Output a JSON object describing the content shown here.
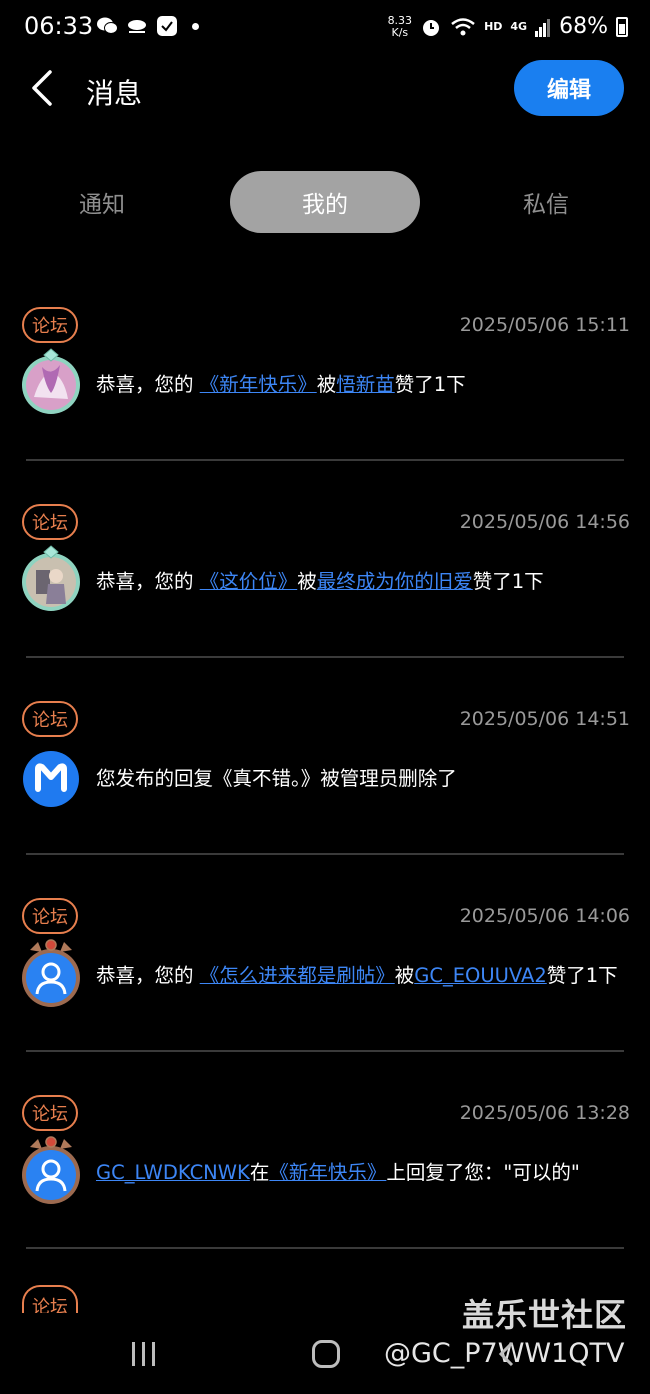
{
  "status_bar": {
    "time": "06:33",
    "speed_value": "8.33",
    "speed_unit": "K/s",
    "network_tag": "HD",
    "signal_tag": "4G",
    "battery": "68%"
  },
  "header": {
    "title": "消息",
    "edit_label": "编辑"
  },
  "tabs": [
    {
      "label": "通知",
      "active": false
    },
    {
      "label": "我的",
      "active": true
    },
    {
      "label": "私信",
      "active": false
    }
  ],
  "items": [
    {
      "badge": "论坛",
      "time": "2025/05/06 15:11",
      "avatar": "anime-avatar",
      "parts": [
        "恭喜，您的 ",
        "《新年快乐》",
        "被",
        "悟新苗",
        "赞了1下"
      ]
    },
    {
      "badge": "论坛",
      "time": "2025/05/06 14:56",
      "avatar": "anime-avatar",
      "parts": [
        "恭喜，您的 ",
        "《这价位》",
        "被",
        "最终成为你的旧爱",
        "赞了1下"
      ]
    },
    {
      "badge": "论坛",
      "time": "2025/05/06 14:51",
      "avatar": "system-m-avatar",
      "text": "您发布的回复《真不错。》被管理员删除了"
    },
    {
      "badge": "论坛",
      "time": "2025/05/06 14:06",
      "avatar": "default-user-avatar",
      "parts": [
        "恭喜，您的 ",
        "《怎么进来都是刷帖》",
        "被",
        "GC_EOUUVA2",
        "赞了1下"
      ]
    },
    {
      "badge": "论坛",
      "time": "2025/05/06 13:28",
      "avatar": "default-user-avatar",
      "reply_parts": [
        "GC_LWDKCNWK",
        "在",
        "《新年快乐》",
        "上回复了您：\"可以的\""
      ]
    }
  ],
  "partial_badge": "论坛",
  "watermark": {
    "name": "盖乐世社区",
    "user": "@GC_P7WW1QTV"
  },
  "colors": {
    "accent": "#1a7ff0",
    "link": "#3d86f5",
    "badge": "#e77f4e",
    "time": "#9a9a9a"
  }
}
